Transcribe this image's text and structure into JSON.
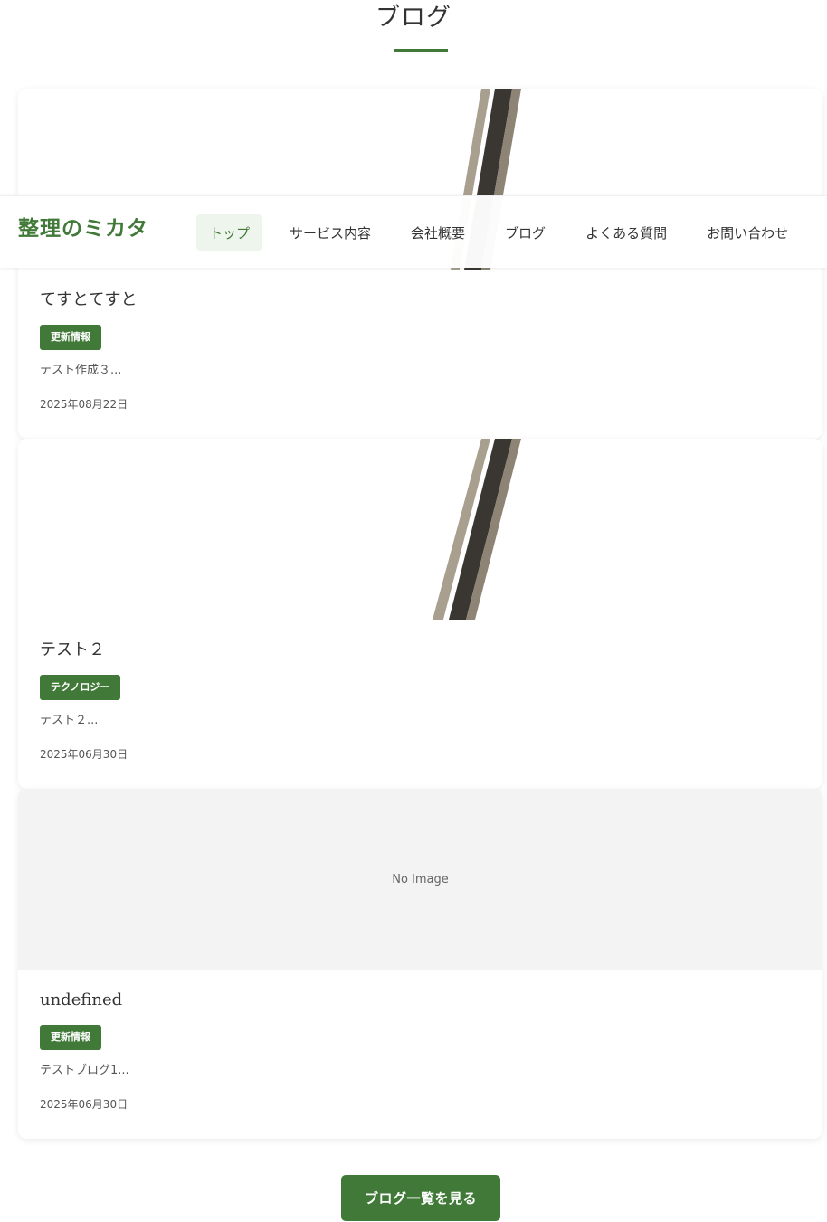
{
  "section": {
    "title": "ブログ"
  },
  "colors": {
    "accent": "#417a38",
    "no_image_bg": "#f3f3f3",
    "nav_active_bg": "#eef5ec"
  },
  "header": {
    "logo": "整理のミカタ",
    "nav": [
      {
        "label": "トップ",
        "active": true
      },
      {
        "label": "サービス内容",
        "active": false
      },
      {
        "label": "会社概要",
        "active": false
      },
      {
        "label": "ブログ",
        "active": false
      },
      {
        "label": "よくある質問",
        "active": false
      },
      {
        "label": "お問い合わせ",
        "active": false
      }
    ]
  },
  "posts": [
    {
      "title": "てすとてすと",
      "category": "更新情報",
      "excerpt": "テスト作成３...",
      "date": "2025年08月22日",
      "thumbnail": "chopsticks-photo"
    },
    {
      "title": "テスト２",
      "category": "テクノロジー",
      "excerpt": "テスト２...",
      "date": "2025年06月30日",
      "thumbnail": "chopsticks-photo"
    },
    {
      "title": "undefined",
      "category": "更新情報",
      "excerpt": "テストブログ1...",
      "date": "2025年06月30日",
      "thumbnail": "none",
      "no_image_text": "No Image"
    }
  ],
  "more_button": {
    "label": "ブログ一覧を見る"
  }
}
